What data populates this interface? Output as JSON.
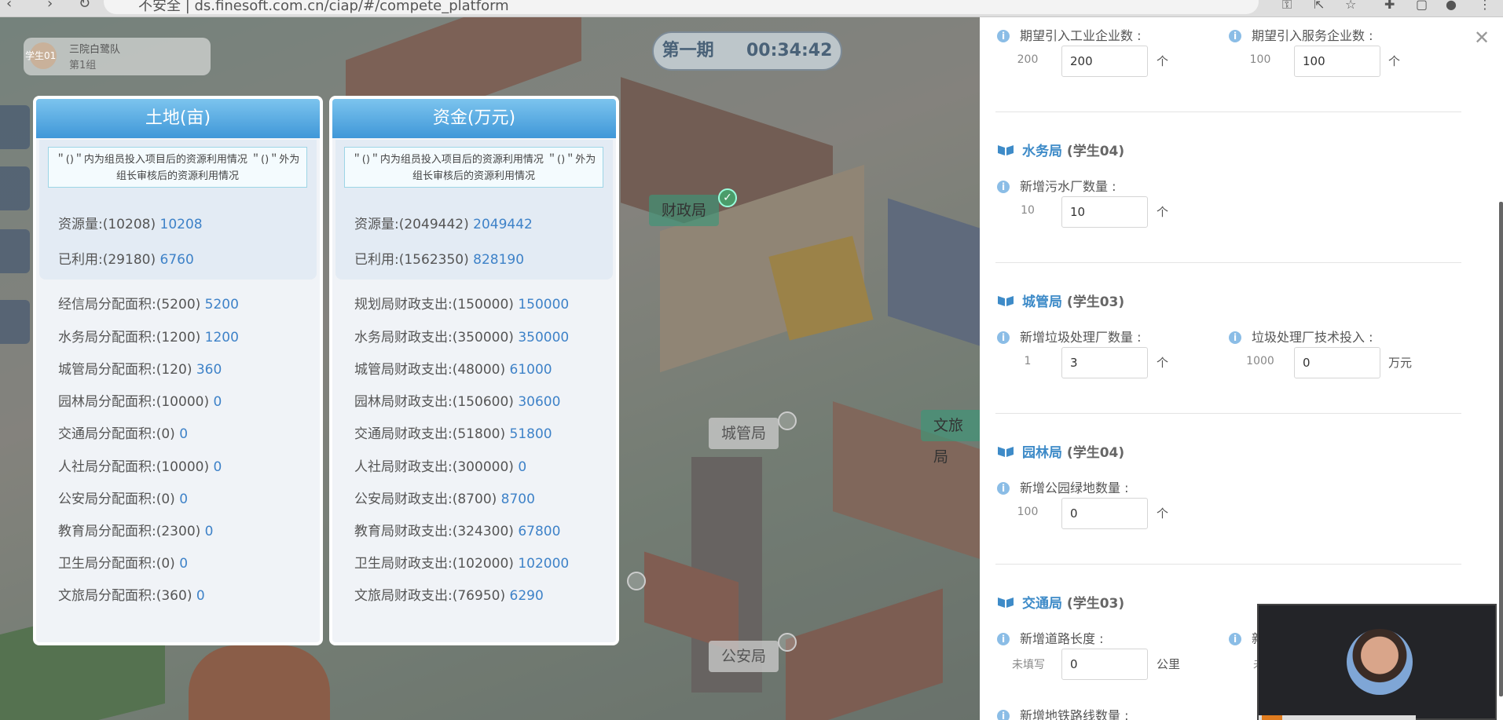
{
  "browser": {
    "url": "不安全 | ds.finesoft.com.cn/ciap/#/compete_platform"
  },
  "team": {
    "student": "学生01",
    "name": "三院白鹭队",
    "group": "第1组"
  },
  "timer": {
    "period": "第一期",
    "time": "00:34:42"
  },
  "map_labels": {
    "finance": "财政局",
    "city": "城管局",
    "culture": "文旅局",
    "police": "公安局"
  },
  "land_panel": {
    "title": "土地(亩)",
    "note": "＂()＂内为组员投入项目后的资源利用情况 ＂()＂外为组长审核后的资源利用情况",
    "rows": [
      {
        "label": "资源量:",
        "pending": "(10208)",
        "value": "10208"
      },
      {
        "label": "已利用:",
        "pending": "(29180)",
        "value": "6760"
      },
      {
        "label": "经信局分配面积:",
        "pending": "(5200)",
        "value": "5200"
      },
      {
        "label": "水务局分配面积:",
        "pending": "(1200)",
        "value": "1200"
      },
      {
        "label": "城管局分配面积:",
        "pending": "(120)",
        "value": "360"
      },
      {
        "label": "园林局分配面积:",
        "pending": "(10000)",
        "value": "0"
      },
      {
        "label": "交通局分配面积:",
        "pending": "(0)",
        "value": "0"
      },
      {
        "label": "人社局分配面积:",
        "pending": "(10000)",
        "value": "0"
      },
      {
        "label": "公安局分配面积:",
        "pending": "(0)",
        "value": "0"
      },
      {
        "label": "教育局分配面积:",
        "pending": "(2300)",
        "value": "0"
      },
      {
        "label": "卫生局分配面积:",
        "pending": "(0)",
        "value": "0"
      },
      {
        "label": "文旅局分配面积:",
        "pending": "(360)",
        "value": "0"
      }
    ]
  },
  "fund_panel": {
    "title": "资金(万元)",
    "note": "＂()＂内为组员投入项目后的资源利用情况 ＂()＂外为组长审核后的资源利用情况",
    "rows": [
      {
        "label": "资源量:",
        "pending": "(2049442)",
        "value": "2049442"
      },
      {
        "label": "已利用:",
        "pending": "(1562350)",
        "value": "828190"
      },
      {
        "label": "规划局财政支出:",
        "pending": "(150000)",
        "value": "150000"
      },
      {
        "label": "水务局财政支出:",
        "pending": "(350000)",
        "value": "350000"
      },
      {
        "label": "城管局财政支出:",
        "pending": "(48000)",
        "value": "61000"
      },
      {
        "label": "园林局财政支出:",
        "pending": "(150600)",
        "value": "30600"
      },
      {
        "label": "交通局财政支出:",
        "pending": "(51800)",
        "value": "51800"
      },
      {
        "label": "人社局财政支出:",
        "pending": "(300000)",
        "value": "0"
      },
      {
        "label": "公安局财政支出:",
        "pending": "(8700)",
        "value": "8700"
      },
      {
        "label": "教育局财政支出:",
        "pending": "(324300)",
        "value": "67800"
      },
      {
        "label": "卫生局财政支出:",
        "pending": "(102000)",
        "value": "102000"
      },
      {
        "label": "文旅局财政支出:",
        "pending": "(76950)",
        "value": "6290"
      }
    ]
  },
  "drawer": {
    "industry": {
      "a": {
        "label": "期望引入工业企业数 :",
        "ref": "200",
        "value": "200",
        "unit": "个"
      },
      "b": {
        "label": "期望引入服务企业数 :",
        "ref": "100",
        "value": "100",
        "unit": "个"
      }
    },
    "water": {
      "title": "水务局",
      "student": "(学生04)",
      "a": {
        "label": "新增污水厂数量 :",
        "ref": "10",
        "value": "10",
        "unit": "个"
      }
    },
    "urban": {
      "title": "城管局",
      "student": "(学生03)",
      "a": {
        "label": "新增垃圾处理厂数量 :",
        "ref": "1",
        "value": "3",
        "unit": "个"
      },
      "b": {
        "label": "垃圾处理厂技术投入 :",
        "ref": "1000",
        "value": "0",
        "unit": "万元"
      }
    },
    "garden": {
      "title": "园林局",
      "student": "(学生04)",
      "a": {
        "label": "新增公园绿地数量 :",
        "ref": "100",
        "value": "0",
        "unit": "个"
      }
    },
    "traffic": {
      "title": "交通局",
      "student": "(学生03)",
      "a": {
        "label": "新增道路长度 :",
        "ref": "未填写",
        "value": "0",
        "unit": "公里"
      },
      "b_label": "新",
      "b_ref": "未填",
      "c": {
        "label": "新增地铁路线数量 :"
      }
    }
  },
  "colors": {
    "accent": "#3e82c8",
    "header": "#4aa3e0",
    "section": "#3e8bc8"
  }
}
